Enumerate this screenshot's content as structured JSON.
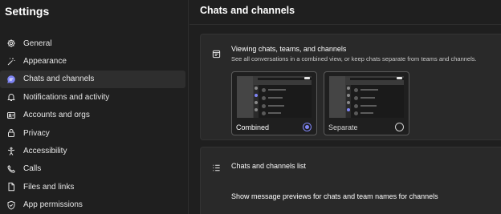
{
  "sidebar": {
    "title": "Settings",
    "items": [
      {
        "label": "General",
        "icon": "gear-icon"
      },
      {
        "label": "Appearance",
        "icon": "magic-wand-icon"
      },
      {
        "label": "Chats and channels",
        "icon": "chat-bubble-icon",
        "active": true
      },
      {
        "label": "Notifications and activity",
        "icon": "bell-icon"
      },
      {
        "label": "Accounts and orgs",
        "icon": "people-icon"
      },
      {
        "label": "Privacy",
        "icon": "lock-icon"
      },
      {
        "label": "Accessibility",
        "icon": "accessibility-icon"
      },
      {
        "label": "Calls",
        "icon": "phone-icon"
      },
      {
        "label": "Files and links",
        "icon": "document-icon"
      },
      {
        "label": "App permissions",
        "icon": "shield-icon"
      }
    ]
  },
  "main": {
    "title": "Chats and channels",
    "viewing": {
      "heading": "Viewing chats, teams, and channels",
      "description": "See all conversations in a combined view, or keep chats separate from teams and channels.",
      "options": [
        {
          "label": "Combined",
          "selected": true
        },
        {
          "label": "Separate",
          "selected": false
        }
      ]
    },
    "list": {
      "heading": "Chats and channels list",
      "preview_setting": "Show message previews for chats and team names for channels"
    }
  },
  "colors": {
    "background": "#1f1f1f",
    "card": "#292929",
    "active_item": "#2e2e2e",
    "accent": "#7f85f5",
    "text": "#ffffff"
  }
}
